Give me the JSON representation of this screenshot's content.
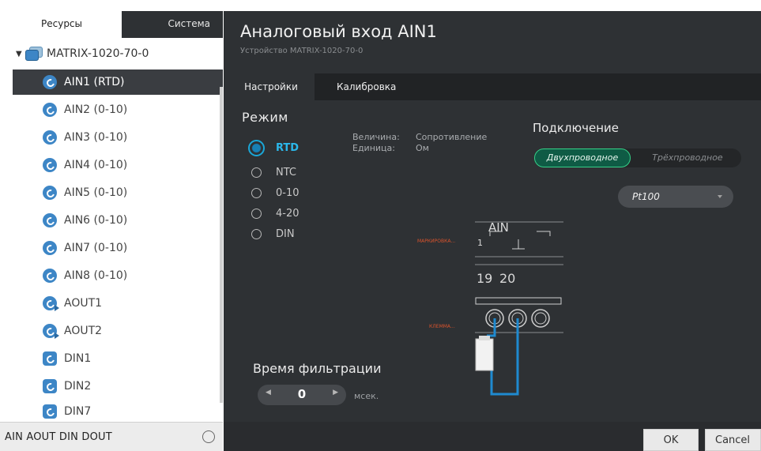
{
  "left_panel": {
    "tabs": [
      "Ресурсы",
      "Система"
    ],
    "root": "MATRIX-1020-70-0",
    "items": [
      {
        "label": "AIN1 (RTD)",
        "icon": "ain-icon"
      },
      {
        "label": "AIN2 (0-10)",
        "icon": "ain-icon"
      },
      {
        "label": "AIN3 (0-10)",
        "icon": "ain-icon"
      },
      {
        "label": "AIN4 (0-10)",
        "icon": "ain-icon"
      },
      {
        "label": "AIN5 (0-10)",
        "icon": "ain-icon"
      },
      {
        "label": "AIN6 (0-10)",
        "icon": "ain-icon"
      },
      {
        "label": "AIN7 (0-10)",
        "icon": "ain-icon"
      },
      {
        "label": "AIN8 (0-10)",
        "icon": "ain-icon"
      },
      {
        "label": "AOUT1",
        "icon": "aout-icon"
      },
      {
        "label": "AOUT2",
        "icon": "aout-icon"
      },
      {
        "label": "DIN1",
        "icon": "din-icon"
      },
      {
        "label": "DIN2",
        "icon": "din-icon"
      },
      {
        "label": "DIN7",
        "icon": "din-icon"
      }
    ],
    "filter": "AIN AOUT DIN DOUT"
  },
  "window": {
    "title": "Аналоговый вход AIN1",
    "subtitle": "Устройство MATRIX-1020-70-0",
    "tabs": [
      "Настройки",
      "Калибровка"
    ]
  },
  "mode": {
    "heading": "Режим",
    "options": [
      "RTD",
      "NTC",
      "0-10",
      "4-20",
      "DIN"
    ],
    "selected": "RTD"
  },
  "info": {
    "quantity_label": "Величина:",
    "quantity_value": "Сопротивление",
    "unit_label": "Единица:",
    "unit_value": "Ом"
  },
  "connection": {
    "heading": "Подключение",
    "two_wire": "Двухпроводное",
    "three_wire": "Трёхпроводное",
    "sensor": "Pt100"
  },
  "diagram": {
    "marking_label": "МАРКИРОВКА...",
    "channel": "AIN",
    "pin_one": "1",
    "terminal_a": "19",
    "terminal_b": "20",
    "terminal_label": "КЛЕММА..."
  },
  "filter_time": {
    "heading": "Время фильтрации",
    "value": "0",
    "unit": "мсек."
  },
  "buttons": {
    "ok": "OK",
    "cancel": "Cancel"
  },
  "colors": {
    "accent": "#1aa7d8",
    "toggle_on": "#35d088",
    "wire": "#1f8ad0"
  }
}
